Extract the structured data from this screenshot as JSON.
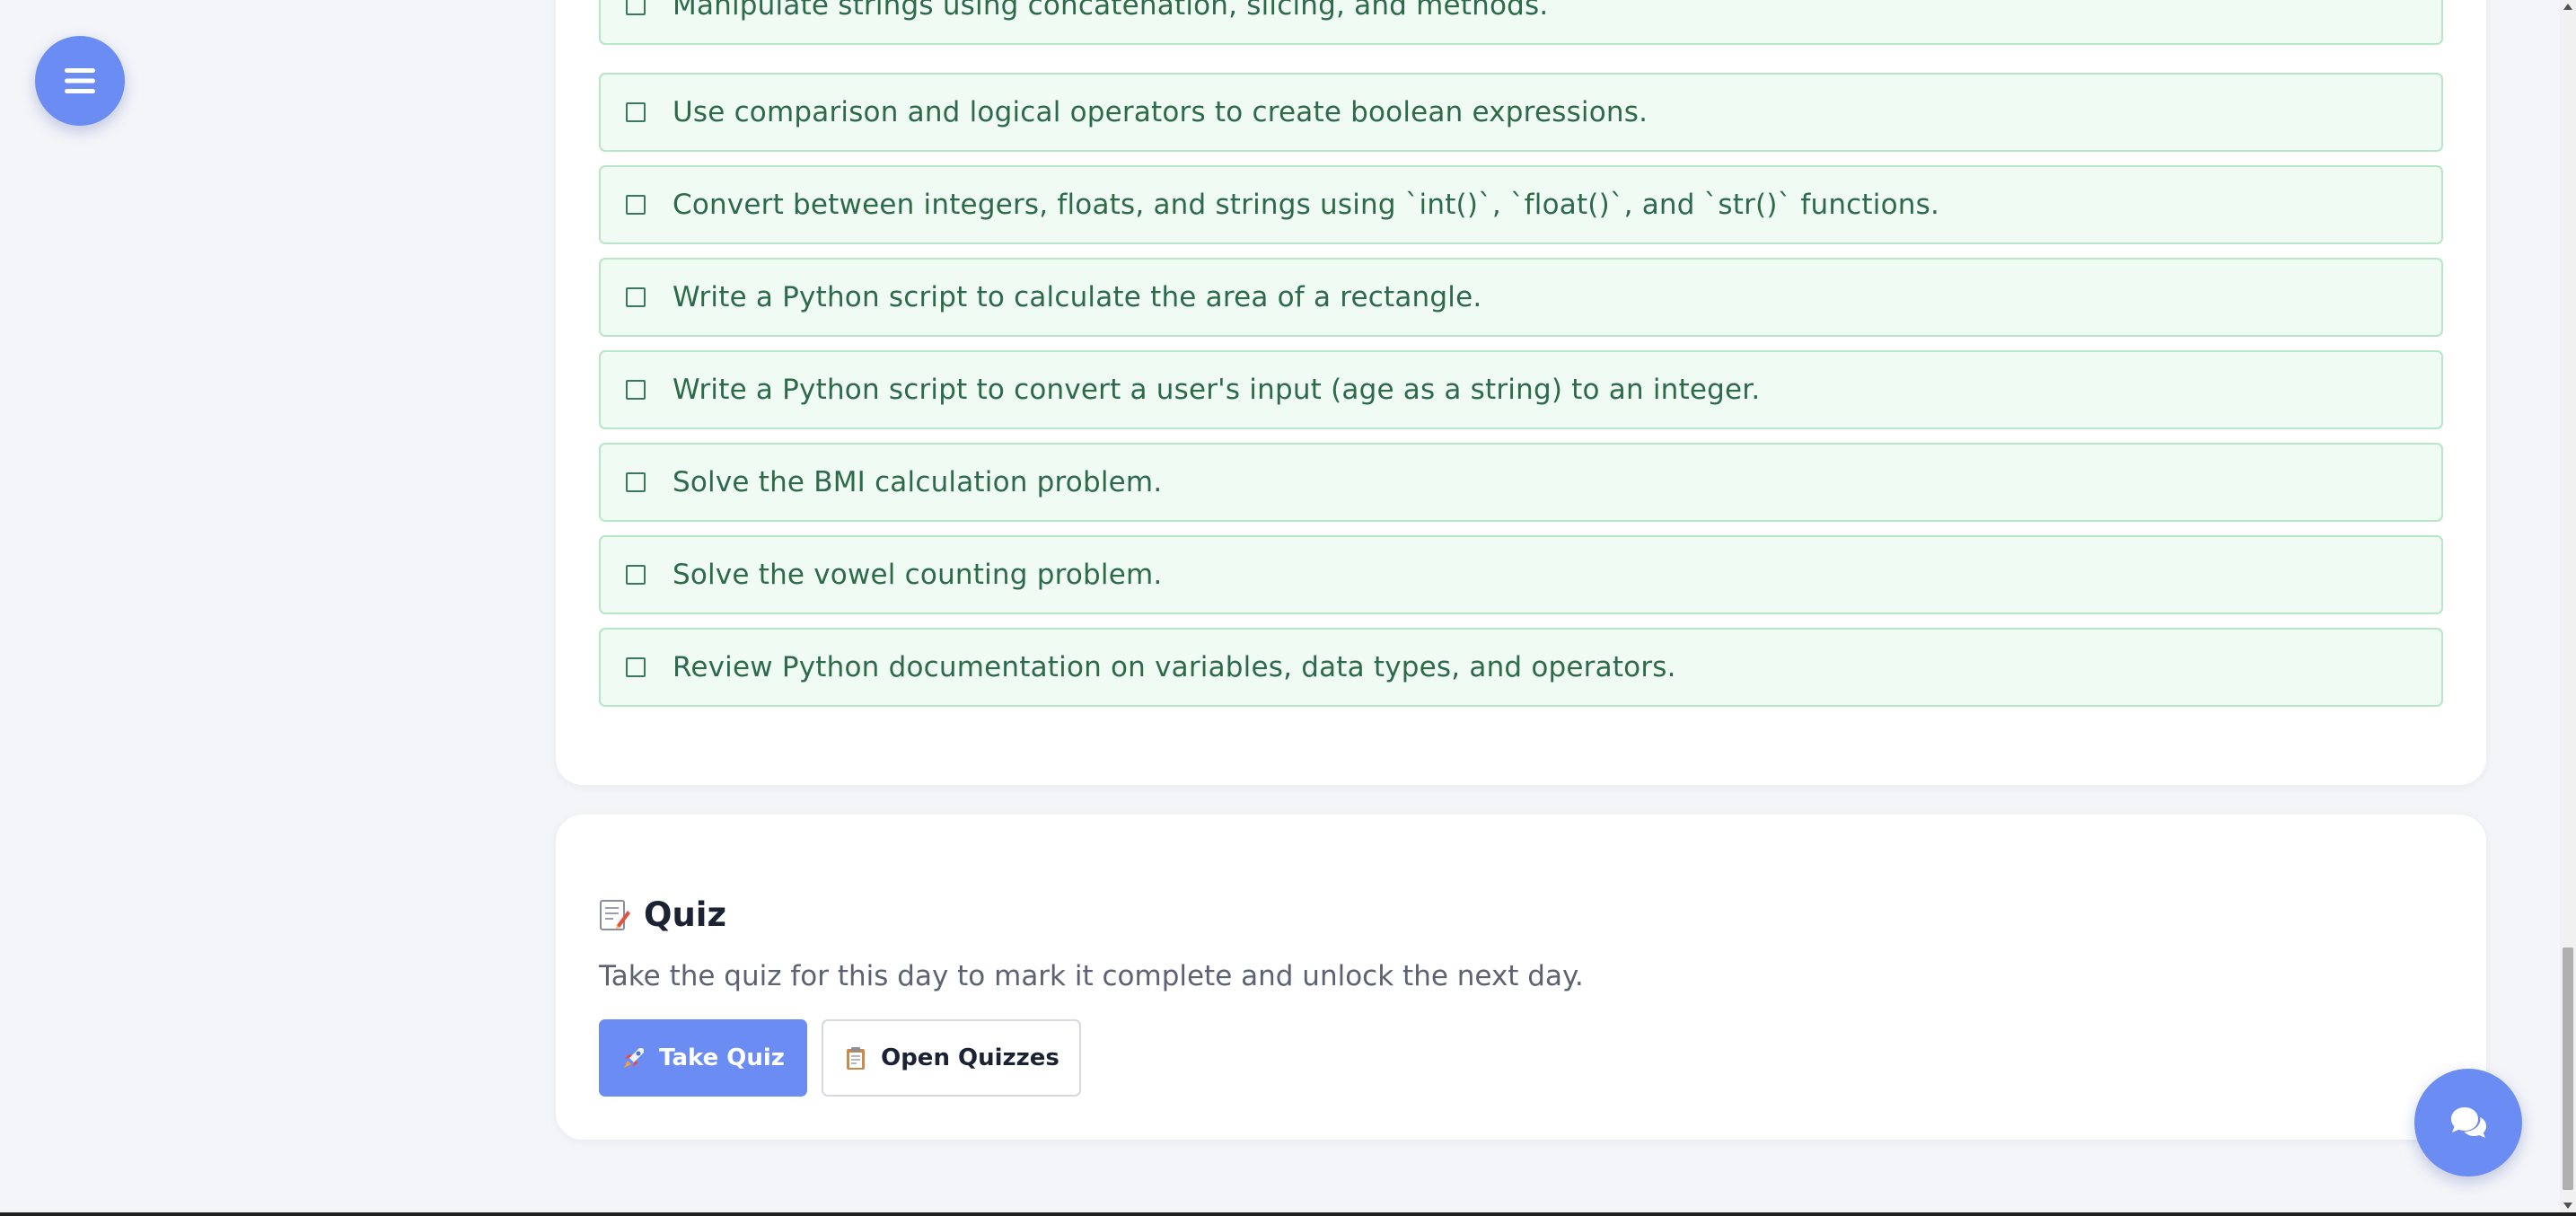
{
  "nav": {
    "menu_icon": "hamburger-icon",
    "chat_icon": "chat-bubbles-icon"
  },
  "checklist": {
    "items": [
      {
        "label": "Manipulate strings using concatenation, slicing, and methods."
      },
      {
        "label": "Use comparison and logical operators to create boolean expressions."
      },
      {
        "label": "Convert between integers, floats, and strings using `int()`, `float()`, and `str()` functions."
      },
      {
        "label": "Write a Python script to calculate the area of a rectangle."
      },
      {
        "label": "Write a Python script to convert a user's input (age as a string) to an integer."
      },
      {
        "label": "Solve the BMI calculation problem."
      },
      {
        "label": "Solve the vowel counting problem."
      },
      {
        "label": "Review Python documentation on variables, data types, and operators."
      }
    ]
  },
  "quiz": {
    "icon": "memo-icon",
    "title": "Quiz",
    "description": "Take the quiz for this day to mark it complete and unlock the next day.",
    "take_quiz": {
      "label": "Take Quiz",
      "icon": "rocket-icon"
    },
    "open_quizzes": {
      "label": "Open Quizzes",
      "icon": "clipboard-icon"
    }
  },
  "colors": {
    "accent": "#6b8cf3",
    "task_bg": "#f0fbf3",
    "task_border": "#b7e6c8",
    "task_text": "#2d6a4a",
    "page_bg": "#f3f5f9"
  }
}
